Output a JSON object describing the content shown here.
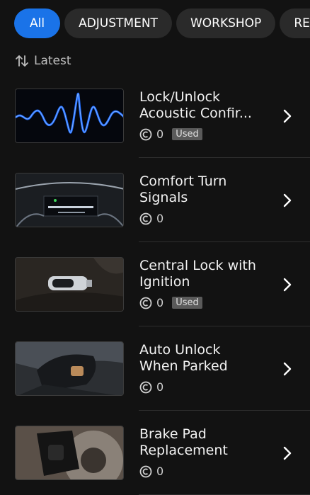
{
  "filters": [
    {
      "label": "All",
      "active": true
    },
    {
      "label": "ADJUSTMENT",
      "active": false
    },
    {
      "label": "WORKSHOP",
      "active": false
    },
    {
      "label": "RE",
      "active": false
    }
  ],
  "sort": {
    "label": "Latest",
    "icon": "sort-arrows-icon"
  },
  "items": [
    {
      "title": "Lock/Unlock Acoustic Confir...",
      "count": "0",
      "badge": "Used",
      "thumb": "waveform-image"
    },
    {
      "title": "Comfort Turn Signals",
      "count": "0",
      "badge": "",
      "thumb": "dashboard-image"
    },
    {
      "title": "Central Lock with Ignition",
      "count": "0",
      "badge": "Used",
      "thumb": "car-key-image"
    },
    {
      "title": "Auto Unlock When Parked",
      "count": "0",
      "badge": "",
      "thumb": "gear-shifter-image"
    },
    {
      "title": "Brake Pad Replacement",
      "count": "0",
      "badge": "",
      "thumb": "brake-caliper-image"
    }
  ],
  "colors": {
    "accent": "#1a73e8",
    "background": "#121212",
    "chip": "#2a2a2a",
    "badge": "#5a5a5a"
  }
}
